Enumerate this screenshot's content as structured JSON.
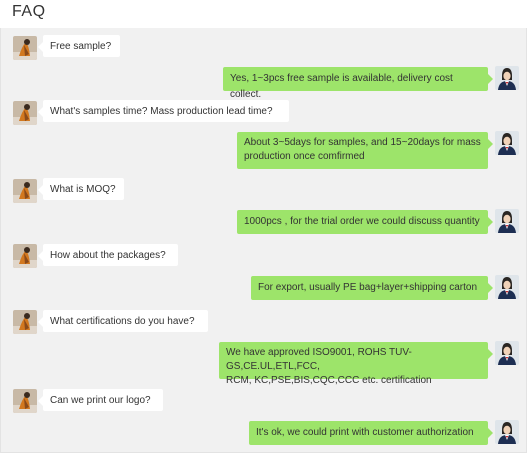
{
  "header": {
    "title": "FAQ"
  },
  "messages": [
    {
      "role": "customer",
      "text": "Free sample?"
    },
    {
      "role": "agent",
      "text": "Yes, 1~3pcs free sample is available, delivery cost collect."
    },
    {
      "role": "customer",
      "text": "What's samples time?  Mass production lead time?"
    },
    {
      "role": "agent",
      "line1": "About 3~5days for samples, and 15~20days for mass",
      "line2": "production once comfirmed"
    },
    {
      "role": "customer",
      "text": "What is MOQ?"
    },
    {
      "role": "agent",
      "text": "1000pcs , for the trial order we could discuss quantity"
    },
    {
      "role": "customer",
      "text": "How about the packages?"
    },
    {
      "role": "agent",
      "text": "For export, usually PE bag+layer+shipping carton"
    },
    {
      "role": "customer",
      "text": "What certifications do you have?"
    },
    {
      "role": "agent",
      "line1": "We have approved ISO9001, ROHS TUV-GS,CE.UL,ETL,FCC,",
      "line2": "RCM, KC,PSE,BIS,CQC,CCC etc. certification"
    },
    {
      "role": "customer",
      "text": "Can we print our logo?"
    },
    {
      "role": "agent",
      "text": "It's ok, we could print with customer authorization"
    }
  ],
  "avatars": {
    "customer": "customer-avatar",
    "agent": "agent-avatar"
  },
  "colors": {
    "agent_bubble": "#9de46a",
    "customer_bubble": "#ffffff",
    "chat_background": "#f1f1f1"
  }
}
